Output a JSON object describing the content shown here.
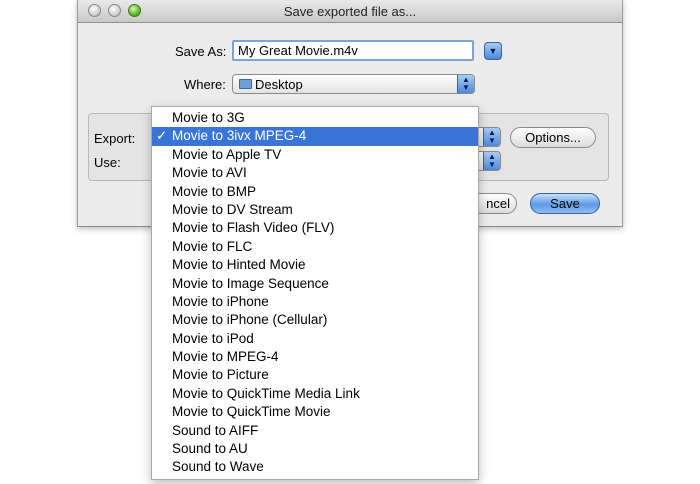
{
  "window": {
    "title": "Save exported file as..."
  },
  "save_as": {
    "label": "Save As:",
    "value": "My Great Movie.m4v"
  },
  "where": {
    "label": "Where:",
    "value": "Desktop"
  },
  "export": {
    "label": "Export:",
    "options_label": "Options..."
  },
  "use": {
    "label": "Use:"
  },
  "buttons": {
    "cancel_label": "ncel",
    "save_label": "Save"
  },
  "menu": {
    "check_mark": "✓",
    "selected_index": 1,
    "items": [
      {
        "label": "Movie to 3G"
      },
      {
        "label": "Movie to 3ivx MPEG-4"
      },
      {
        "label": "Movie to Apple TV"
      },
      {
        "label": "Movie to AVI"
      },
      {
        "label": "Movie to BMP"
      },
      {
        "label": "Movie to DV Stream"
      },
      {
        "label": "Movie to Flash Video (FLV)"
      },
      {
        "label": "Movie to FLC"
      },
      {
        "label": "Movie to Hinted Movie"
      },
      {
        "label": "Movie to Image Sequence"
      },
      {
        "label": "Movie to iPhone"
      },
      {
        "label": "Movie to iPhone (Cellular)"
      },
      {
        "label": "Movie to iPod"
      },
      {
        "label": "Movie to MPEG-4"
      },
      {
        "label": "Movie to Picture"
      },
      {
        "label": "Movie to QuickTime Media Link"
      },
      {
        "label": "Movie to QuickTime Movie"
      },
      {
        "label": "Sound to AIFF"
      },
      {
        "label": "Sound to AU"
      },
      {
        "label": "Sound to Wave"
      }
    ]
  },
  "colors": {
    "selection": "#3875d7",
    "default_button": "#5d9ae6"
  }
}
